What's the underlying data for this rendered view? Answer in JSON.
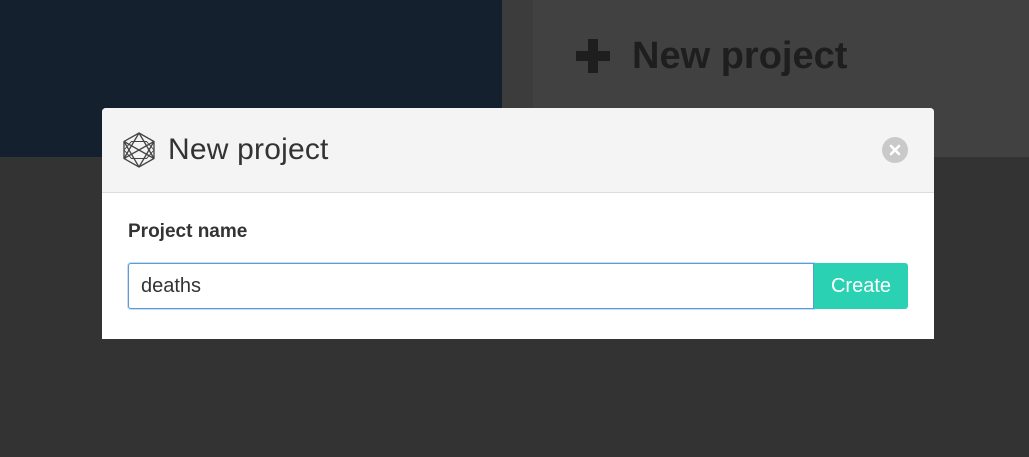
{
  "background": {
    "new_project_label": "New project"
  },
  "modal": {
    "title": "New project",
    "icon": "hexagon-logo-icon",
    "close_icon": "close-icon",
    "field_label": "Project name",
    "input_value": "deaths",
    "create_label": "Create"
  },
  "colors": {
    "overlay": "#333333",
    "accent": "#2bd1b3",
    "focus_border": "#5b9dd9",
    "navy": "#14202d"
  }
}
